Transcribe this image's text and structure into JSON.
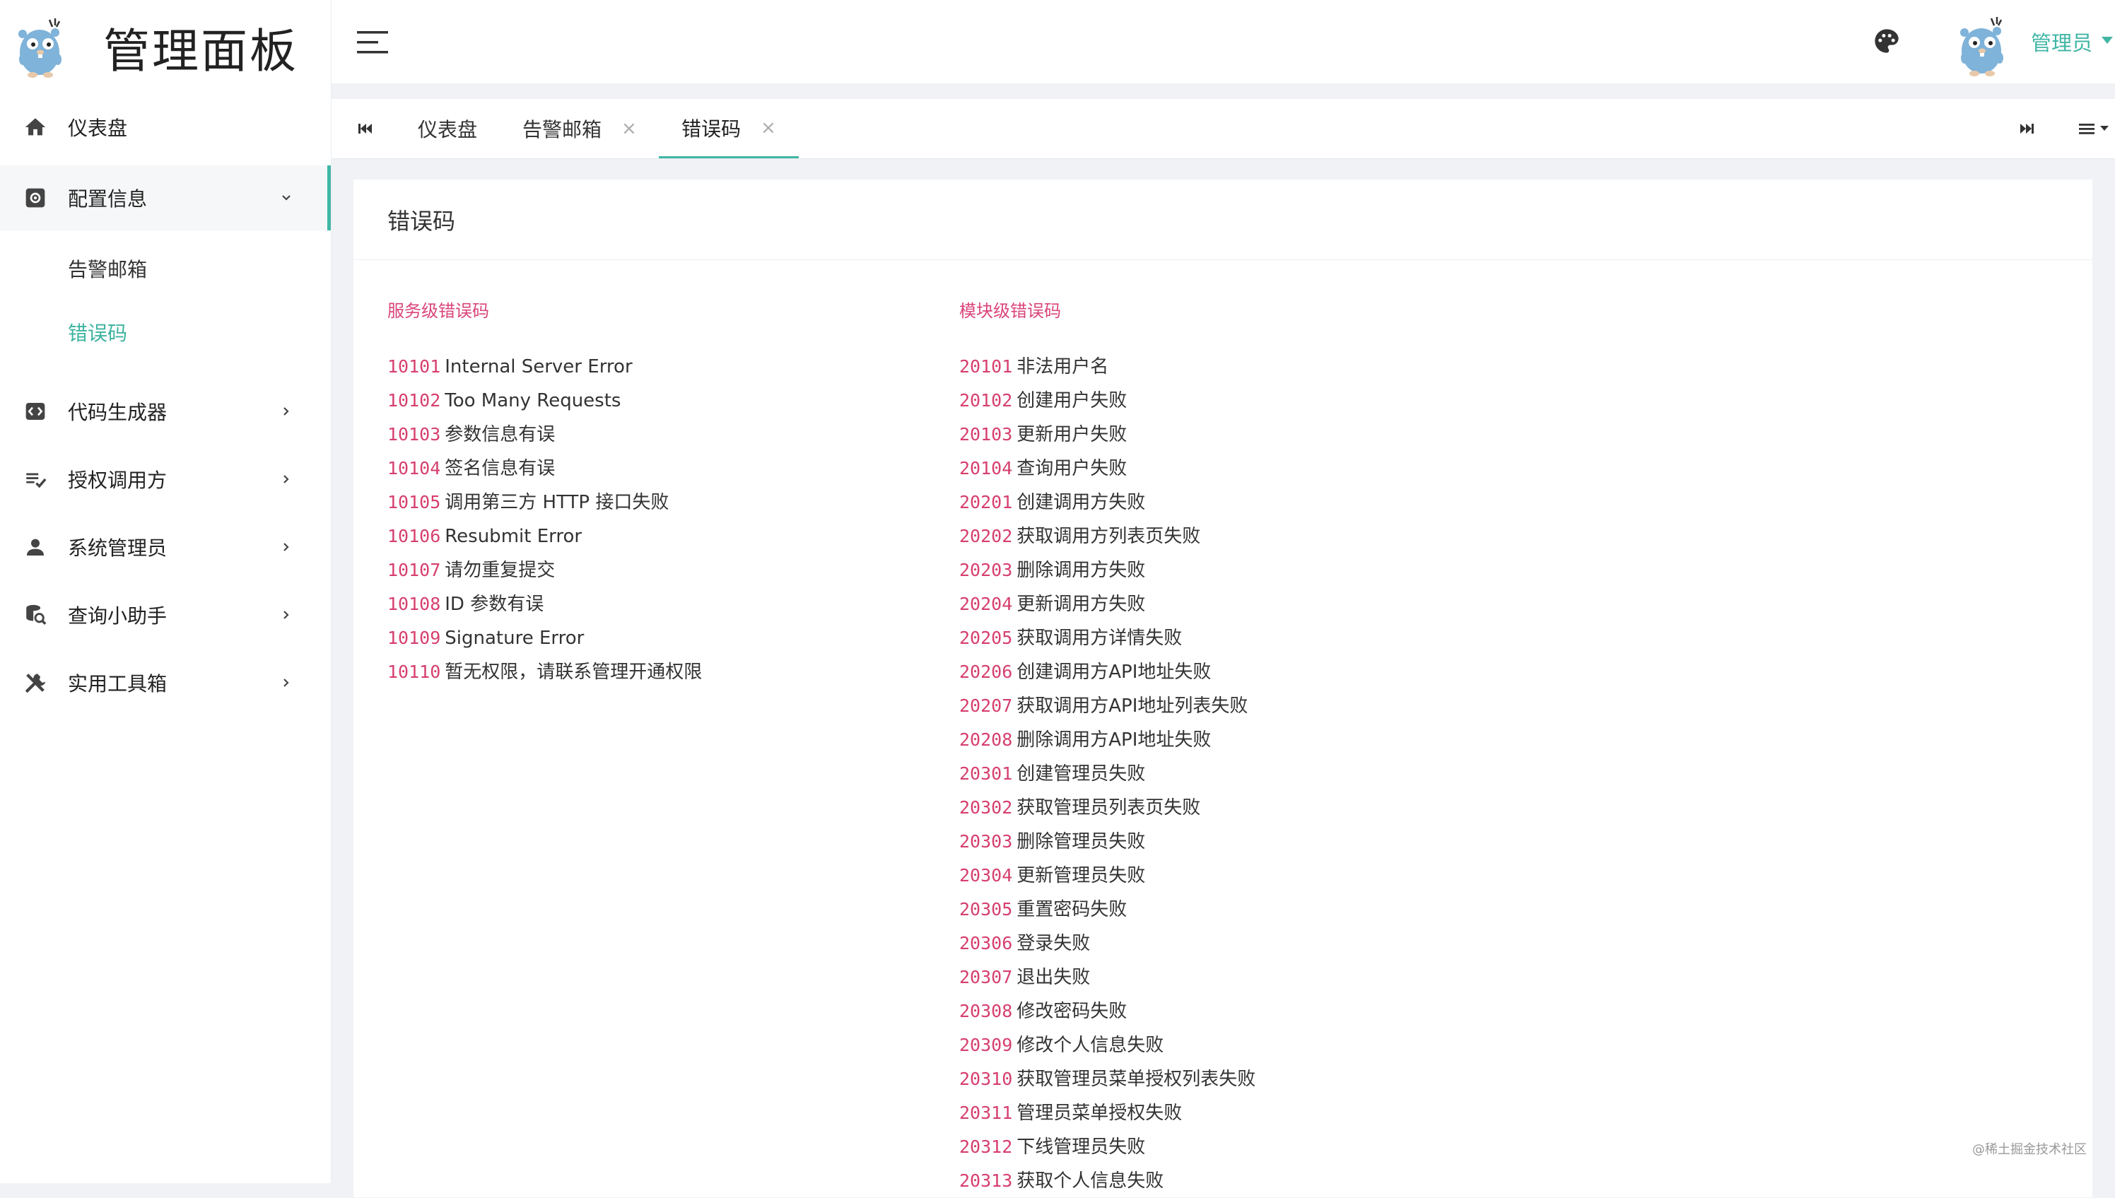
{
  "brand": {
    "title": "管理面板"
  },
  "header": {
    "admin_name": "管理员"
  },
  "sidebar": {
    "items": [
      {
        "label": "仪表盘",
        "icon": "home-icon"
      },
      {
        "label": "配置信息",
        "icon": "settings-box-icon",
        "open": true
      },
      {
        "label": "代码生成器",
        "icon": "code-box-icon"
      },
      {
        "label": "授权调用方",
        "icon": "playlist-check-icon"
      },
      {
        "label": "系统管理员",
        "icon": "user-icon"
      },
      {
        "label": "查询小助手",
        "icon": "database-search-icon"
      },
      {
        "label": "实用工具箱",
        "icon": "tools-icon"
      }
    ],
    "sub_items": [
      {
        "label": "告警邮箱",
        "active": false
      },
      {
        "label": "错误码",
        "active": true
      }
    ]
  },
  "tabs": [
    {
      "label": "仪表盘",
      "closable": false
    },
    {
      "label": "告警邮箱",
      "closable": true,
      "close": "×"
    },
    {
      "label": "错误码",
      "closable": true,
      "close": "×",
      "active": true
    }
  ],
  "page": {
    "title": "错误码",
    "service_title": "服务级错误码",
    "module_title": "模块级错误码",
    "service_codes": [
      {
        "code": "10101",
        "desc": "Internal Server Error"
      },
      {
        "code": "10102",
        "desc": "Too Many Requests"
      },
      {
        "code": "10103",
        "desc": "参数信息有误"
      },
      {
        "code": "10104",
        "desc": "签名信息有误"
      },
      {
        "code": "10105",
        "desc": "调用第三方 HTTP 接口失败"
      },
      {
        "code": "10106",
        "desc": "Resubmit Error"
      },
      {
        "code": "10107",
        "desc": "请勿重复提交"
      },
      {
        "code": "10108",
        "desc": "ID 参数有误"
      },
      {
        "code": "10109",
        "desc": "Signature Error"
      },
      {
        "code": "10110",
        "desc": "暂无权限，请联系管理开通权限"
      }
    ],
    "module_codes": [
      {
        "code": "20101",
        "desc": "非法用户名"
      },
      {
        "code": "20102",
        "desc": "创建用户失败"
      },
      {
        "code": "20103",
        "desc": "更新用户失败"
      },
      {
        "code": "20104",
        "desc": "查询用户失败"
      },
      {
        "code": "20201",
        "desc": "创建调用方失败"
      },
      {
        "code": "20202",
        "desc": "获取调用方列表页失败"
      },
      {
        "code": "20203",
        "desc": "删除调用方失败"
      },
      {
        "code": "20204",
        "desc": "更新调用方失败"
      },
      {
        "code": "20205",
        "desc": "获取调用方详情失败"
      },
      {
        "code": "20206",
        "desc": "创建调用方API地址失败"
      },
      {
        "code": "20207",
        "desc": "获取调用方API地址列表失败"
      },
      {
        "code": "20208",
        "desc": "删除调用方API地址失败"
      },
      {
        "code": "20301",
        "desc": "创建管理员失败"
      },
      {
        "code": "20302",
        "desc": "获取管理员列表页失败"
      },
      {
        "code": "20303",
        "desc": "删除管理员失败"
      },
      {
        "code": "20304",
        "desc": "更新管理员失败"
      },
      {
        "code": "20305",
        "desc": "重置密码失败"
      },
      {
        "code": "20306",
        "desc": "登录失败"
      },
      {
        "code": "20307",
        "desc": "退出失败"
      },
      {
        "code": "20308",
        "desc": "修改密码失败"
      },
      {
        "code": "20309",
        "desc": "修改个人信息失败"
      },
      {
        "code": "20310",
        "desc": "获取管理员菜单授权列表失败"
      },
      {
        "code": "20311",
        "desc": "管理员菜单授权失败"
      },
      {
        "code": "20312",
        "desc": "下线管理员失败"
      },
      {
        "code": "20313",
        "desc": "获取个人信息失败"
      }
    ]
  },
  "watermark": "@稀土掘金技术社区",
  "colors": {
    "accent": "#41b6a5",
    "code": "#d63f6e",
    "section_title": "#d9457a"
  }
}
